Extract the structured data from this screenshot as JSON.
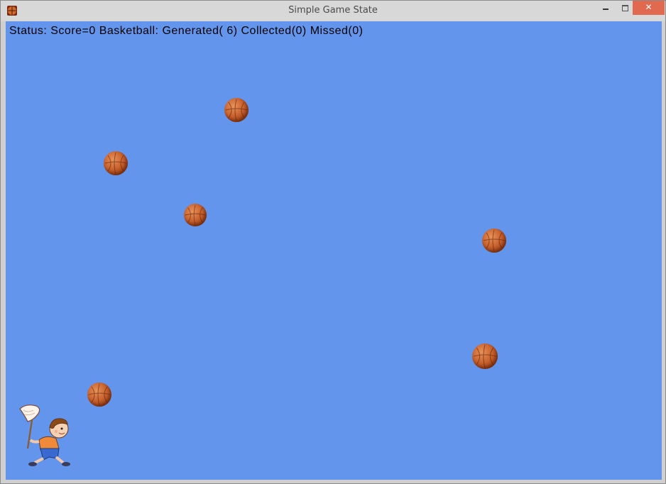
{
  "window": {
    "title": "Simple Game State",
    "controls": {
      "minimize_icon": "minimize-icon",
      "maximize_icon": "maximize-icon",
      "close_label": "✕"
    }
  },
  "game": {
    "status_text": "Status: Score=0 Basketball: Generated( 6) Collected(0) Missed(0)",
    "score": 0,
    "generated": 6,
    "collected": 0,
    "missed": 0,
    "background_color": "#6495ed",
    "ball_count_on_screen": 6,
    "player_sprite": "boy-with-net"
  }
}
